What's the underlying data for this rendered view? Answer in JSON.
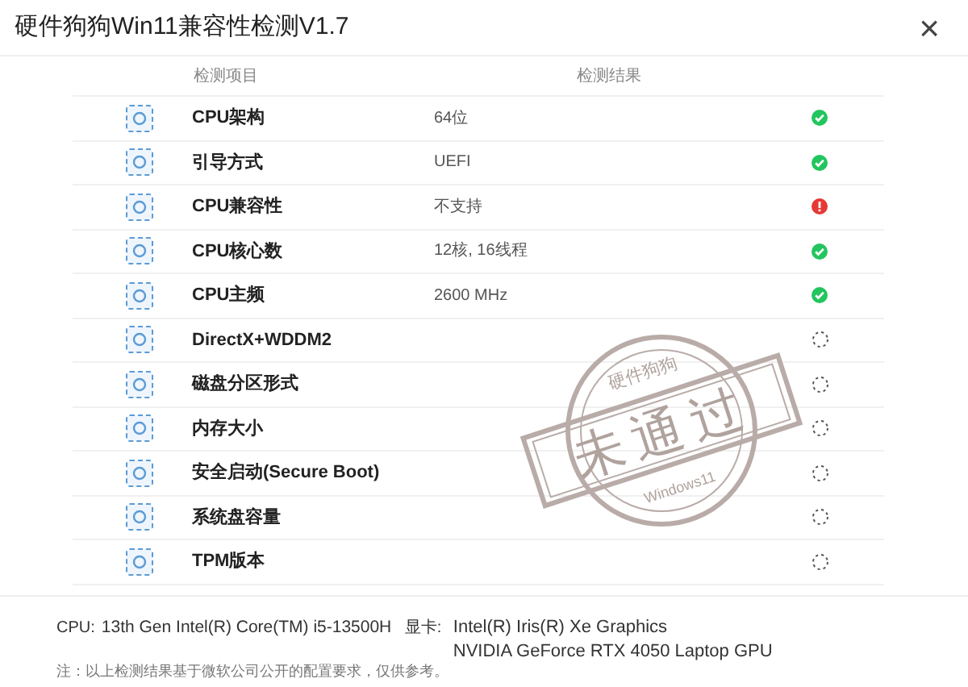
{
  "window": {
    "title": "硬件狗狗Win11兼容性检测V1.7",
    "close": "×"
  },
  "columns": [
    "检测项目",
    "检测结果"
  ],
  "rows": [
    {
      "name": "CPU架构",
      "value": "64位",
      "kind": "pass"
    },
    {
      "name": "引导方式",
      "value": "UEFI",
      "kind": "pass"
    },
    {
      "name": "CPU兼容性",
      "value": "不支持",
      "kind": "fail"
    },
    {
      "name": "CPU核心数",
      "value": "12核, 16线程",
      "kind": "pass"
    },
    {
      "name": "CPU主频",
      "value": "2600 MHz",
      "kind": "pass"
    },
    {
      "name": "DirectX+WDDM2",
      "kind": "pending"
    },
    {
      "name": "磁盘分区形式",
      "kind": "pending"
    },
    {
      "name": "内存大小",
      "kind": "pending"
    },
    {
      "name": "安全启动(Secure Boot)",
      "kind": "pending"
    },
    {
      "name": "系统盘容量",
      "kind": "pending"
    },
    {
      "name": "TPM版本",
      "kind": "pending"
    }
  ],
  "stamp": {
    "top_text": "硬件狗狗",
    "main_text": "未通过",
    "bottom_text": "Windows11"
  },
  "footer": {
    "cpu_label": "CPU:",
    "cpu_value": "13th Gen Intel(R) Core(TM) i5-13500H",
    "gpu_label": "显卡:",
    "gpu_values": [
      "Intel(R) Iris(R) Xe Graphics",
      "NVIDIA GeForce RTX 4050 Laptop GPU"
    ],
    "note": "注：以上检测结果基于微软公司公开的配置要求，仅供参考。"
  }
}
